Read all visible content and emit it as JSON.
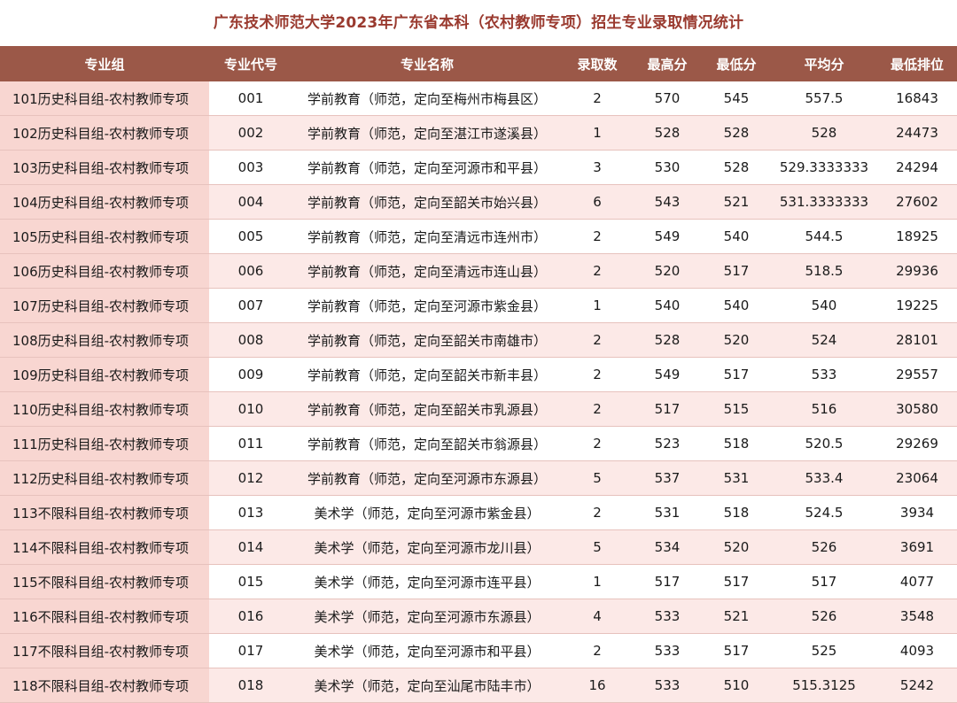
{
  "title": "广东技术师范大学2023年广东省本科（农村教师专项）招生专业录取情况统计",
  "columns": [
    "专业组",
    "专业代号",
    "专业名称",
    "录取数",
    "最高分",
    "最低分",
    "平均分",
    "最低排位"
  ],
  "rows": [
    [
      "101历史科目组-农村教师专项",
      "001",
      "学前教育（师范，定向至梅州市梅县区）",
      "2",
      "570",
      "545",
      "557.5",
      "16843"
    ],
    [
      "102历史科目组-农村教师专项",
      "002",
      "学前教育（师范，定向至湛江市遂溪县）",
      "1",
      "528",
      "528",
      "528",
      "24473"
    ],
    [
      "103历史科目组-农村教师专项",
      "003",
      "学前教育（师范，定向至河源市和平县）",
      "3",
      "530",
      "528",
      "529.3333333",
      "24294"
    ],
    [
      "104历史科目组-农村教师专项",
      "004",
      "学前教育（师范，定向至韶关市始兴县）",
      "6",
      "543",
      "521",
      "531.3333333",
      "27602"
    ],
    [
      "105历史科目组-农村教师专项",
      "005",
      "学前教育（师范，定向至清远市连州市）",
      "2",
      "549",
      "540",
      "544.5",
      "18925"
    ],
    [
      "106历史科目组-农村教师专项",
      "006",
      "学前教育（师范，定向至清远市连山县）",
      "2",
      "520",
      "517",
      "518.5",
      "29936"
    ],
    [
      "107历史科目组-农村教师专项",
      "007",
      "学前教育（师范，定向至河源市紫金县）",
      "1",
      "540",
      "540",
      "540",
      "19225"
    ],
    [
      "108历史科目组-农村教师专项",
      "008",
      "学前教育（师范，定向至韶关市南雄市）",
      "2",
      "528",
      "520",
      "524",
      "28101"
    ],
    [
      "109历史科目组-农村教师专项",
      "009",
      "学前教育（师范，定向至韶关市新丰县）",
      "2",
      "549",
      "517",
      "533",
      "29557"
    ],
    [
      "110历史科目组-农村教师专项",
      "010",
      "学前教育（师范，定向至韶关市乳源县）",
      "2",
      "517",
      "515",
      "516",
      "30580"
    ],
    [
      "111历史科目组-农村教师专项",
      "011",
      "学前教育（师范，定向至韶关市翁源县）",
      "2",
      "523",
      "518",
      "520.5",
      "29269"
    ],
    [
      "112历史科目组-农村教师专项",
      "012",
      "学前教育（师范，定向至河源市东源县）",
      "5",
      "537",
      "531",
      "533.4",
      "23064"
    ],
    [
      "113不限科目组-农村教师专项",
      "013",
      "美术学（师范，定向至河源市紫金县）",
      "2",
      "531",
      "518",
      "524.5",
      "3934"
    ],
    [
      "114不限科目组-农村教师专项",
      "014",
      "美术学（师范，定向至河源市龙川县）",
      "5",
      "534",
      "520",
      "526",
      "3691"
    ],
    [
      "115不限科目组-农村教师专项",
      "015",
      "美术学（师范，定向至河源市连平县）",
      "1",
      "517",
      "517",
      "517",
      "4077"
    ],
    [
      "116不限科目组-农村教师专项",
      "016",
      "美术学（师范，定向至河源市东源县）",
      "4",
      "533",
      "521",
      "526",
      "3548"
    ],
    [
      "117不限科目组-农村教师专项",
      "017",
      "美术学（师范，定向至河源市和平县）",
      "2",
      "533",
      "517",
      "525",
      "4093"
    ],
    [
      "118不限科目组-农村教师专项",
      "018",
      "美术学（师范，定向至汕尾市陆丰市）",
      "16",
      "533",
      "510",
      "515.3125",
      "5242"
    ]
  ]
}
